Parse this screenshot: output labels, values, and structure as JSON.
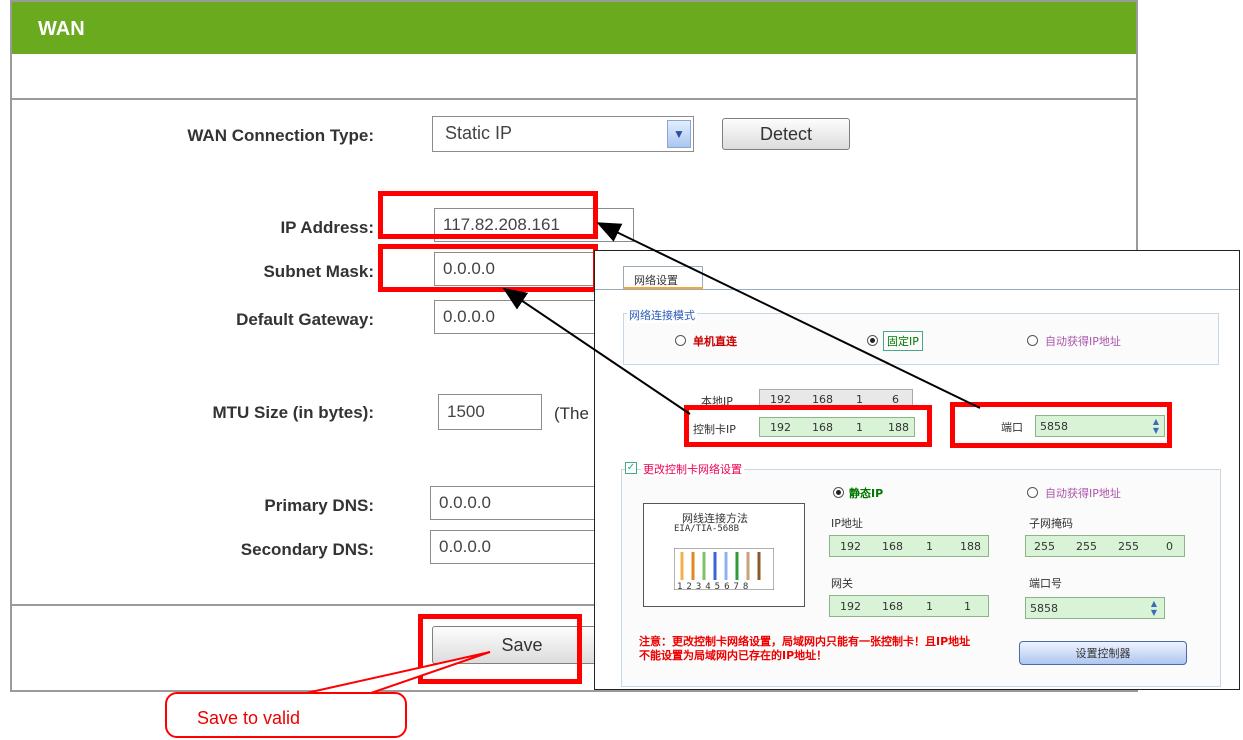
{
  "wan": {
    "title": "WAN",
    "connection_type_label": "WAN Connection Type:",
    "connection_type_value": "Static IP",
    "detect_label": "Detect",
    "ip_label": "IP Address:",
    "ip_value": "117.82.208.161",
    "mask_label": "Subnet Mask:",
    "mask_value": "0.0.0.0",
    "gateway_label": "Default Gateway:",
    "gateway_value": "0.0.0.0",
    "mtu_label": "MTU Size (in bytes):",
    "mtu_value": "1500",
    "mtu_note": "(The",
    "primary_dns_label": "Primary DNS:",
    "primary_dns_value": "0.0.0.0",
    "secondary_dns_label": "Secondary DNS:",
    "secondary_dns_value": "0.0.0.0",
    "save_label": "Save"
  },
  "dialog": {
    "tab_label": "网络设置",
    "mode_group_title": "网络连接模式",
    "mode_options": [
      "单机直连",
      "固定IP",
      "自动获得IP地址"
    ],
    "selected_mode": "固定IP",
    "local_ip_label": "本地IP",
    "local_ip": [
      "192",
      "168",
      "1",
      "6"
    ],
    "controller_ip_label": "控制卡IP",
    "controller_ip": [
      "192",
      "168",
      "1",
      "188"
    ],
    "port_label": "端口",
    "port_value": "5858",
    "change_checkbox_label": "更改控制卡网络设置",
    "static_ip_label": "静态IP",
    "auto_ip_label": "自动获得IP地址",
    "diagram_title": "网线连接方法",
    "diagram_subtitle": "EIA/TIA-568B",
    "diagram_pins": "12345678",
    "ip_addr_label": "IP地址",
    "ip_addr": [
      "192",
      "168",
      "1",
      "188"
    ],
    "subnet_label": "子网掩码",
    "subnet": [
      "255",
      "255",
      "255",
      "0"
    ],
    "gateway_label": "网关",
    "gateway": [
      "192",
      "168",
      "1",
      "1"
    ],
    "port_no_label": "端口号",
    "port_no_value": "5858",
    "warning": "注意：更改控制卡网络设置，局域网内只能有一张控制卡！且IP地址不能设置为局域网内已存在的IP地址！",
    "set_button_label": "设置控制器"
  },
  "callout": {
    "text": "Save to valid"
  },
  "colors": {
    "header_green": "#69aa1f",
    "highlight_red": "#ff0000",
    "field_green": "#d9f3d6"
  }
}
